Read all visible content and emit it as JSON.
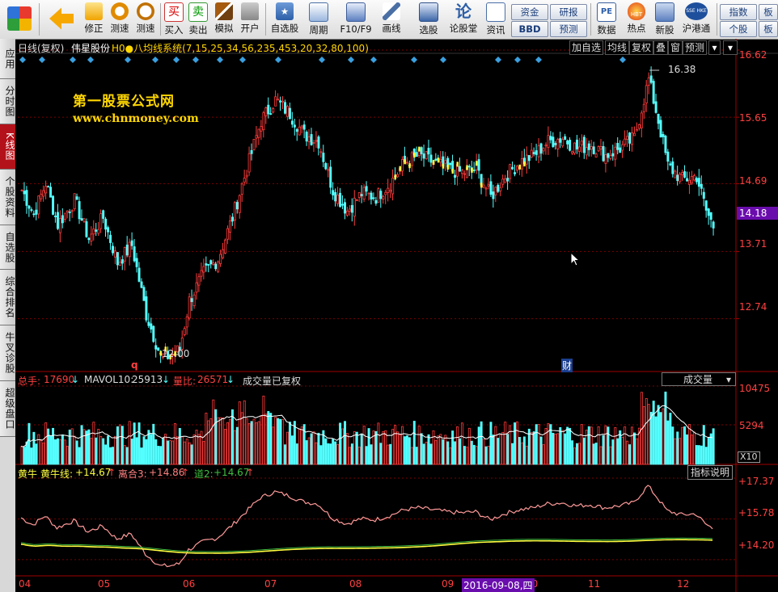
{
  "toolbar": {
    "buttons": [
      {
        "label": "",
        "icon": "app-logo-icon"
      },
      {
        "label": "",
        "icon": "back-arrow-icon"
      },
      {
        "label": "修正",
        "icon": "up-down-icon"
      },
      {
        "label": "测速",
        "icon": "speed-icon"
      },
      {
        "label": "测速",
        "icon": "clock-icon"
      },
      {
        "label": "买入",
        "icon": "buy-icon"
      },
      {
        "label": "卖出",
        "icon": "sell-icon"
      },
      {
        "label": "模拟",
        "icon": "hammer-icon"
      },
      {
        "label": "开户",
        "icon": "lock-icon"
      },
      {
        "label": "自选股",
        "icon": "star-icon"
      },
      {
        "label": "周期",
        "icon": "period-icon"
      },
      {
        "label": "F10/F9",
        "icon": "f10-icon"
      },
      {
        "label": "画线",
        "icon": "pen-icon"
      },
      {
        "label": "选股",
        "icon": "select-stock-icon"
      },
      {
        "label": "论股堂",
        "icon": "forum-icon"
      },
      {
        "label": "资讯",
        "icon": "news-icon"
      },
      {
        "label": "数据",
        "icon": "pe-icon"
      },
      {
        "label": "热点",
        "icon": "hot-icon"
      },
      {
        "label": "新股",
        "icon": "ipo-icon"
      },
      {
        "label": "沪港通",
        "icon": "hk-connect-icon"
      }
    ],
    "small_buttons": [
      "资金",
      "研报",
      "BBD",
      "预测",
      "指数",
      "个股",
      "板"
    ],
    "pe_badge": "PE",
    "hbt_badge": "HBT",
    "sse_badge": "SSE HKE"
  },
  "left_tabs": [
    {
      "label": "应用",
      "active": false
    },
    {
      "label": "分时图",
      "active": false
    },
    {
      "label": "K线图",
      "active": true
    },
    {
      "label": "个股资料",
      "active": false
    },
    {
      "label": "自选股",
      "active": false
    },
    {
      "label": "综合排名",
      "active": false
    },
    {
      "label": "牛叉诊股",
      "active": false
    },
    {
      "label": "超级盘口",
      "active": false
    }
  ],
  "chart_header": {
    "period_label": "日线(复权)",
    "stock_name": "伟星股份",
    "indicator": "H0●八均线系统(7,15,25,34,56,235,453,20,32,80,100)",
    "right_buttons": [
      "加自选",
      "均线",
      "复权",
      "叠",
      "窗",
      "预测"
    ]
  },
  "watermark": {
    "line1": "第一股票公式网",
    "line2": "www.chnmoney.com"
  },
  "price_axis": {
    "labels": [
      "16.62",
      "15.65",
      "14.69",
      "13.71",
      "12.74"
    ],
    "current": "14.18",
    "high_marker": "16.38",
    "low_marker": "12.00",
    "q_marker": "q",
    "cai_marker": "财"
  },
  "volume_panel": {
    "total_label": "总手:",
    "total_value": "17690",
    "mavol_label": "MAVOL10:",
    "mavol_value": "25913",
    "ratio_label": "量比:",
    "ratio_value": "26571",
    "note": "成交量已复权",
    "selector": "成交量",
    "axis": [
      "10475",
      "5294"
    ],
    "unit": "X10"
  },
  "indicator_panel": {
    "name": "黄牛",
    "line1_label": "黄牛线:",
    "line1_value": "+14.67",
    "line2_label": "离合3:",
    "line2_value": "+14.86",
    "line3_label": "道2:",
    "line3_value": "+14.67",
    "help_button": "指标说明",
    "axis": [
      "+17.37",
      "+15.78",
      "+14.20"
    ]
  },
  "date_axis": {
    "months": [
      "04",
      "05",
      "06",
      "07",
      "08",
      "09",
      "10",
      "11",
      "12"
    ],
    "cursor_date": "2016-09-08,四"
  },
  "colors": {
    "up": "#ff3b3b",
    "down": "#54ffff",
    "yellow": "#ffff40",
    "accent_red": "#b4121a",
    "current_bg": "#6a0dad"
  },
  "chart_data": {
    "type": "candlestick",
    "x_labels": [
      "04",
      "05",
      "06",
      "07",
      "08",
      "09",
      "10",
      "11",
      "12"
    ],
    "price_ylim": [
      12.0,
      16.62
    ],
    "price_ticks": [
      16.62,
      15.65,
      14.69,
      13.71,
      12.74
    ],
    "anchors": [
      [
        0,
        14.6
      ],
      [
        5,
        14.25
      ],
      [
        10,
        14.7
      ],
      [
        15,
        14.1
      ],
      [
        22,
        14.45
      ],
      [
        28,
        13.9
      ],
      [
        34,
        14.2
      ],
      [
        40,
        13.55
      ],
      [
        46,
        13.8
      ],
      [
        52,
        12.8
      ],
      [
        58,
        12.2
      ],
      [
        62,
        12.2
      ],
      [
        66,
        12.3
      ],
      [
        70,
        13.0
      ],
      [
        76,
        13.4
      ],
      [
        82,
        13.6
      ],
      [
        88,
        14.2
      ],
      [
        94,
        14.9
      ],
      [
        100,
        15.6
      ],
      [
        106,
        15.9
      ],
      [
        112,
        15.7
      ],
      [
        118,
        15.4
      ],
      [
        124,
        15.3
      ],
      [
        130,
        14.6
      ],
      [
        136,
        14.3
      ],
      [
        142,
        14.55
      ],
      [
        148,
        14.5
      ],
      [
        154,
        14.7
      ],
      [
        160,
        15.0
      ],
      [
        166,
        15.1
      ],
      [
        172,
        15.0
      ],
      [
        178,
        14.9
      ],
      [
        184,
        14.85
      ],
      [
        190,
        14.9
      ],
      [
        196,
        14.5
      ],
      [
        202,
        14.8
      ],
      [
        208,
        15.0
      ],
      [
        214,
        15.1
      ],
      [
        220,
        15.3
      ],
      [
        226,
        15.35
      ],
      [
        232,
        15.2
      ],
      [
        238,
        15.25
      ],
      [
        244,
        15.1
      ],
      [
        250,
        15.2
      ],
      [
        256,
        15.35
      ],
      [
        262,
        16.2
      ],
      [
        266,
        15.6
      ],
      [
        270,
        14.95
      ],
      [
        276,
        14.75
      ],
      [
        282,
        14.8
      ],
      [
        286,
        14.3
      ],
      [
        290,
        14.0
      ]
    ],
    "candles": 290,
    "volume_ylim": [
      0,
      10475
    ],
    "volume_ticks": [
      10475,
      5294
    ],
    "indicator_ylim": [
      13.6,
      17.37
    ],
    "indicator_ticks": [
      17.37,
      15.78,
      14.2
    ]
  }
}
